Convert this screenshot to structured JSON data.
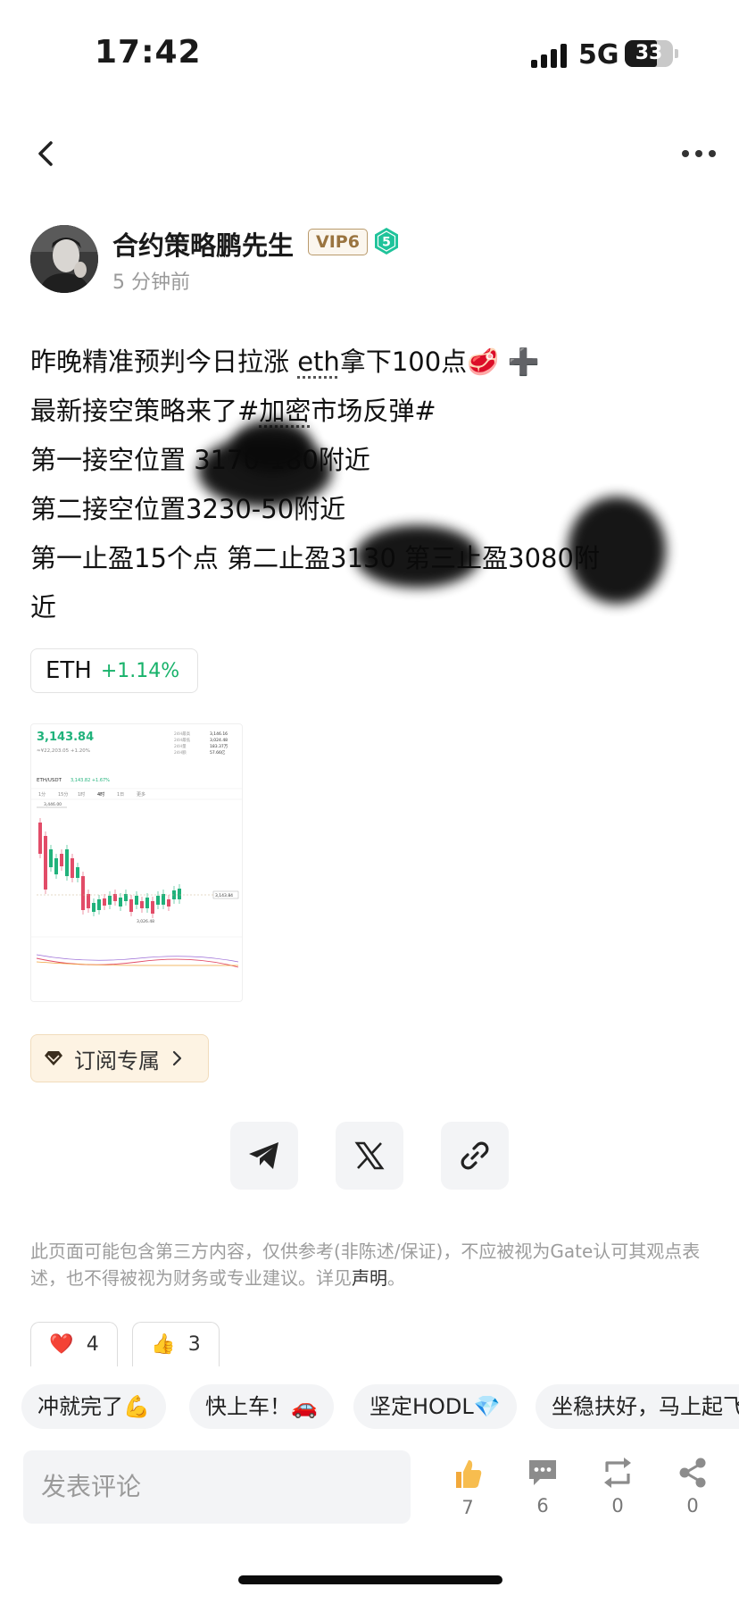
{
  "status_bar": {
    "time": "17:42",
    "network": "5G",
    "battery": "33"
  },
  "author": {
    "name": "合约策略鹏先生",
    "vip_badge": "VIP6",
    "level": "5",
    "time_ago": "5 分钟前"
  },
  "post": {
    "line1_a": "昨晚精准预判今日拉涨 ",
    "line1_eth": "eth",
    "line1_b": "拿下100点🥩 ➕",
    "line2_a": " 最新接空策略来了#",
    "line2_tag": "加密",
    "line2_b": "市场反弹#",
    "line3": "第一接空位置 3170-180附近",
    "line4": "第二接空位置3230-50附近",
    "line5": "第一止盈15个点 第二止盈3130 第三止盈3080附",
    "line6": "近"
  },
  "coin_tag": {
    "symbol": "ETH",
    "change": "+1.14%"
  },
  "chart_thumb": {
    "price": "3,143.84",
    "sub": "≈¥22,203.05  +1.20%",
    "pair": "ETH/USDT",
    "pair_change": "3,143.82 +1.67%",
    "tabs": [
      "1分",
      "15分",
      "1时",
      "4时",
      "1日",
      "更多"
    ],
    "high_label": "3,446.00",
    "low_label": "3,026.48",
    "last_label": "3,143.84",
    "stats": [
      {
        "k": "24H最高",
        "v": "3,146.16"
      },
      {
        "k": "24H最低",
        "v": "3,024.48"
      },
      {
        "k": "24H量",
        "v": "183.37万"
      },
      {
        "k": "24H额",
        "v": "57.66亿"
      }
    ]
  },
  "subscribe": {
    "label": "订阅专属"
  },
  "share_buttons": [
    "telegram",
    "x",
    "link"
  ],
  "disclaimer": {
    "text": "此页面可能包含第三方内容，仅供参考(非陈述/保证)，不应被视为Gate认可其观点表述，也不得被视为财务或专业建议。详见",
    "link": "声明",
    "end": "。"
  },
  "reactions": [
    {
      "emoji": "❤️",
      "count": "4"
    },
    {
      "emoji": "👍",
      "count": "3"
    }
  ],
  "quick_replies": [
    "冲就完了💪",
    "快上车！🚗",
    "坚定HODL💎",
    "坐稳扶好，马上起飞"
  ],
  "comment": {
    "placeholder": "发表评论"
  },
  "actions": {
    "likes": "7",
    "comments": "6",
    "reposts": "0",
    "shares": "0"
  },
  "colors": {
    "accent_green": "#17b26a",
    "vip_gold": "#9a7440",
    "red_candle": "#e24c68",
    "green_candle": "#20b27b"
  }
}
